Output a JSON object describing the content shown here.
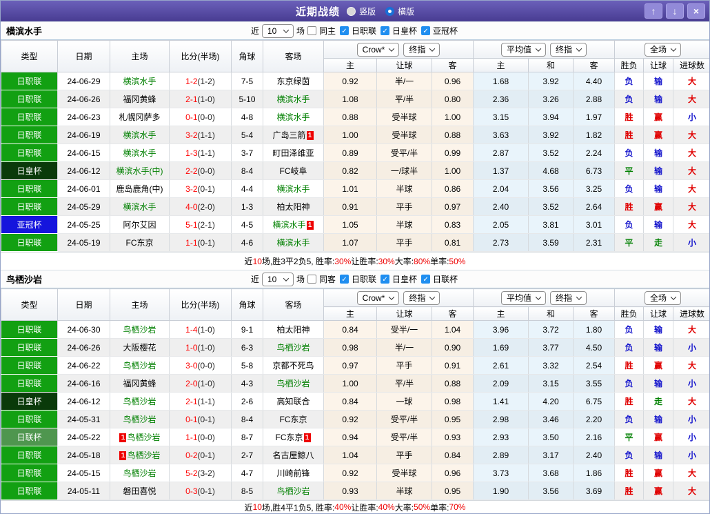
{
  "titlebar": {
    "title": "近期战绩",
    "radios": [
      {
        "label": "竖版",
        "selected": false
      },
      {
        "label": "横版",
        "selected": true
      }
    ],
    "icons": {
      "up": "↑",
      "down": "↓",
      "close": "×"
    }
  },
  "columns": {
    "type": "类型",
    "date": "日期",
    "home": "主场",
    "score": "比分(半场)",
    "corner": "角球",
    "away": "客场",
    "sub": [
      "主",
      "让球",
      "客",
      "主",
      "和",
      "客",
      "胜负",
      "让球",
      "进球数"
    ]
  },
  "type_colors": {
    "日职联": "#12a012",
    "日皇杯": "#0a3a0a",
    "亚冠杯": "#1515dd",
    "日联杯": "#4f964f"
  },
  "result_colors": {
    "胜": "r",
    "赢": "r",
    "大": "r",
    "负": "b",
    "输": "b",
    "小": "b",
    "平": "g",
    "走": "g"
  },
  "sections": [
    {
      "team": "横滨水手",
      "filter": {
        "prefix": "近",
        "count": "10",
        "suffix": "场",
        "same": "同主",
        "leagues": [
          "日职联",
          "日皇杯",
          "亚冠杯"
        ]
      },
      "dropdowns": {
        "odds_source": "Crow*",
        "final_a": "终指",
        "average": "平均值",
        "final_b": "终指",
        "scope": "全场"
      },
      "rows": [
        {
          "type": "日职联",
          "date": "24-06-29",
          "home": "横滨水手",
          "home_self": true,
          "score": "1-2",
          "half": "(1-2)",
          "corner": "7-5",
          "away": "东京绿茵",
          "crow": [
            "0.92",
            "半/一",
            "0.96"
          ],
          "avg": [
            "1.68",
            "3.92",
            "4.40"
          ],
          "result": [
            "负",
            "输",
            "大"
          ]
        },
        {
          "type": "日职联",
          "date": "24-06-26",
          "home": "福冈黄蜂",
          "score": "2-1",
          "half": "(1-0)",
          "corner": "5-10",
          "away": "横滨水手",
          "away_self": true,
          "crow": [
            "1.08",
            "平/半",
            "0.80"
          ],
          "avg": [
            "2.36",
            "3.26",
            "2.88"
          ],
          "result": [
            "负",
            "输",
            "大"
          ]
        },
        {
          "type": "日职联",
          "date": "24-06-23",
          "home": "札幌冈萨多",
          "score": "0-1",
          "half": "(0-0)",
          "corner": "4-8",
          "away": "横滨水手",
          "away_self": true,
          "crow": [
            "0.88",
            "受半球",
            "1.00"
          ],
          "avg": [
            "3.15",
            "3.94",
            "1.97"
          ],
          "result": [
            "胜",
            "赢",
            "小"
          ]
        },
        {
          "type": "日职联",
          "date": "24-06-19",
          "home": "横滨水手",
          "home_self": true,
          "score": "3-2",
          "half": "(1-1)",
          "corner": "5-4",
          "away": "广岛三箭",
          "away_badge": "1",
          "crow": [
            "1.00",
            "受半球",
            "0.88"
          ],
          "avg": [
            "3.63",
            "3.92",
            "1.82"
          ],
          "result": [
            "胜",
            "赢",
            "大"
          ]
        },
        {
          "type": "日职联",
          "date": "24-06-15",
          "home": "横滨水手",
          "home_self": true,
          "score": "1-3",
          "half": "(1-1)",
          "corner": "3-7",
          "away": "町田泽维亚",
          "crow": [
            "0.89",
            "受平/半",
            "0.99"
          ],
          "avg": [
            "2.87",
            "3.52",
            "2.24"
          ],
          "result": [
            "负",
            "输",
            "大"
          ]
        },
        {
          "type": "日皇杯",
          "date": "24-06-12",
          "home": "横滨水手(中)",
          "home_self": true,
          "score": "2-2",
          "half": "(0-0)",
          "corner": "8-4",
          "away": "FC岐阜",
          "crow": [
            "0.82",
            "一/球半",
            "1.00"
          ],
          "avg": [
            "1.37",
            "4.68",
            "6.73"
          ],
          "result": [
            "平",
            "输",
            "大"
          ]
        },
        {
          "type": "日职联",
          "date": "24-06-01",
          "home": "鹿岛鹿角(中)",
          "score": "3-2",
          "half": "(0-1)",
          "corner": "4-4",
          "away": "横滨水手",
          "away_self": true,
          "crow": [
            "1.01",
            "半球",
            "0.86"
          ],
          "avg": [
            "2.04",
            "3.56",
            "3.25"
          ],
          "result": [
            "负",
            "输",
            "大"
          ]
        },
        {
          "type": "日职联",
          "date": "24-05-29",
          "home": "横滨水手",
          "home_self": true,
          "score": "4-0",
          "half": "(2-0)",
          "corner": "1-3",
          "away": "柏太阳神",
          "crow": [
            "0.91",
            "平手",
            "0.97"
          ],
          "avg": [
            "2.40",
            "3.52",
            "2.64"
          ],
          "result": [
            "胜",
            "赢",
            "大"
          ]
        },
        {
          "type": "亚冠杯",
          "date": "24-05-25",
          "home": "阿尔艾因",
          "score": "5-1",
          "half": "(2-1)",
          "corner": "4-5",
          "away": "横滨水手",
          "away_self": true,
          "away_badge": "1",
          "crow": [
            "1.05",
            "半球",
            "0.83"
          ],
          "avg": [
            "2.05",
            "3.81",
            "3.01"
          ],
          "result": [
            "负",
            "输",
            "大"
          ]
        },
        {
          "type": "日职联",
          "date": "24-05-19",
          "home": "FC东京",
          "score": "1-1",
          "half": "(0-1)",
          "corner": "4-6",
          "away": "横滨水手",
          "away_self": true,
          "crow": [
            "1.07",
            "平手",
            "0.81"
          ],
          "avg": [
            "2.73",
            "3.59",
            "2.31"
          ],
          "result": [
            "平",
            "走",
            "小"
          ]
        }
      ],
      "summary": [
        {
          "text": "近"
        },
        {
          "text": "10",
          "red": true
        },
        {
          "text": "场,胜3平2负5, 胜率:"
        },
        {
          "text": "30%",
          "red": true
        },
        {
          "text": " 让胜率:"
        },
        {
          "text": "30%",
          "red": true
        },
        {
          "text": " 大率:"
        },
        {
          "text": "80%",
          "red": true
        },
        {
          "text": " 单率:"
        },
        {
          "text": "50%",
          "red": true
        }
      ]
    },
    {
      "team": "鸟栖沙岩",
      "filter": {
        "prefix": "近",
        "count": "10",
        "suffix": "场",
        "same": "同客",
        "leagues": [
          "日职联",
          "日皇杯",
          "日联杯"
        ]
      },
      "dropdowns": {
        "odds_source": "Crow*",
        "final_a": "终指",
        "average": "平均值",
        "final_b": "终指",
        "scope": "全场"
      },
      "rows": [
        {
          "type": "日职联",
          "date": "24-06-30",
          "home": "鸟栖沙岩",
          "home_self": true,
          "score": "1-4",
          "half": "(1-0)",
          "corner": "9-1",
          "away": "柏太阳神",
          "crow": [
            "0.84",
            "受半/一",
            "1.04"
          ],
          "avg": [
            "3.96",
            "3.72",
            "1.80"
          ],
          "result": [
            "负",
            "输",
            "大"
          ]
        },
        {
          "type": "日职联",
          "date": "24-06-26",
          "home": "大阪樱花",
          "score": "1-0",
          "half": "(1-0)",
          "corner": "6-3",
          "away": "鸟栖沙岩",
          "away_self": true,
          "crow": [
            "0.98",
            "半/一",
            "0.90"
          ],
          "avg": [
            "1.69",
            "3.77",
            "4.50"
          ],
          "result": [
            "负",
            "输",
            "小"
          ]
        },
        {
          "type": "日职联",
          "date": "24-06-22",
          "home": "鸟栖沙岩",
          "home_self": true,
          "score": "3-0",
          "half": "(0-0)",
          "corner": "5-8",
          "away": "京都不死鸟",
          "crow": [
            "0.97",
            "平手",
            "0.91"
          ],
          "avg": [
            "2.61",
            "3.32",
            "2.54"
          ],
          "result": [
            "胜",
            "赢",
            "大"
          ]
        },
        {
          "type": "日职联",
          "date": "24-06-16",
          "home": "福冈黄蜂",
          "score": "2-0",
          "half": "(1-0)",
          "corner": "4-3",
          "away": "鸟栖沙岩",
          "away_self": true,
          "crow": [
            "1.00",
            "平/半",
            "0.88"
          ],
          "avg": [
            "2.09",
            "3.15",
            "3.55"
          ],
          "result": [
            "负",
            "输",
            "小"
          ]
        },
        {
          "type": "日皇杯",
          "date": "24-06-12",
          "home": "鸟栖沙岩",
          "home_self": true,
          "score": "2-1",
          "half": "(1-1)",
          "corner": "2-6",
          "away": "高知联合",
          "crow": [
            "0.84",
            "一球",
            "0.98"
          ],
          "avg": [
            "1.41",
            "4.20",
            "6.75"
          ],
          "result": [
            "胜",
            "走",
            "大"
          ]
        },
        {
          "type": "日职联",
          "date": "24-05-31",
          "home": "鸟栖沙岩",
          "home_self": true,
          "score": "0-1",
          "half": "(0-1)",
          "corner": "8-4",
          "away": "FC东京",
          "crow": [
            "0.92",
            "受平/半",
            "0.95"
          ],
          "avg": [
            "2.98",
            "3.46",
            "2.20"
          ],
          "result": [
            "负",
            "输",
            "小"
          ]
        },
        {
          "type": "日联杯",
          "date": "24-05-22",
          "home": "鸟栖沙岩",
          "home_self": true,
          "home_badge": "1",
          "score": "1-1",
          "half": "(0-0)",
          "corner": "8-7",
          "away": "FC东京",
          "away_badge": "1",
          "crow": [
            "0.94",
            "受平/半",
            "0.93"
          ],
          "avg": [
            "2.93",
            "3.50",
            "2.16"
          ],
          "result": [
            "平",
            "赢",
            "小"
          ]
        },
        {
          "type": "日职联",
          "date": "24-05-18",
          "home": "鸟栖沙岩",
          "home_self": true,
          "home_badge": "1",
          "score": "0-2",
          "half": "(0-1)",
          "corner": "2-7",
          "away": "名古屋鲸八",
          "crow": [
            "1.04",
            "平手",
            "0.84"
          ],
          "avg": [
            "2.89",
            "3.17",
            "2.40"
          ],
          "result": [
            "负",
            "输",
            "小"
          ]
        },
        {
          "type": "日职联",
          "date": "24-05-15",
          "home": "鸟栖沙岩",
          "home_self": true,
          "score": "5-2",
          "half": "(3-2)",
          "corner": "4-7",
          "away": "川崎前锋",
          "crow": [
            "0.92",
            "受半球",
            "0.96"
          ],
          "avg": [
            "3.73",
            "3.68",
            "1.86"
          ],
          "result": [
            "胜",
            "赢",
            "大"
          ]
        },
        {
          "type": "日职联",
          "date": "24-05-11",
          "home": "磐田喜悦",
          "score": "0-3",
          "half": "(0-1)",
          "corner": "8-5",
          "away": "鸟栖沙岩",
          "away_self": true,
          "crow": [
            "0.93",
            "半球",
            "0.95"
          ],
          "avg": [
            "1.90",
            "3.56",
            "3.69"
          ],
          "result": [
            "胜",
            "赢",
            "大"
          ]
        }
      ],
      "summary": [
        {
          "text": "近"
        },
        {
          "text": "10",
          "red": true
        },
        {
          "text": "场,胜4平1负5, 胜率:"
        },
        {
          "text": "40%",
          "red": true
        },
        {
          "text": " 让胜率:"
        },
        {
          "text": "40%",
          "red": true
        },
        {
          "text": " 大率:"
        },
        {
          "text": "50%",
          "red": true
        },
        {
          "text": " 单率:"
        },
        {
          "text": "70%",
          "red": true
        }
      ]
    }
  ]
}
